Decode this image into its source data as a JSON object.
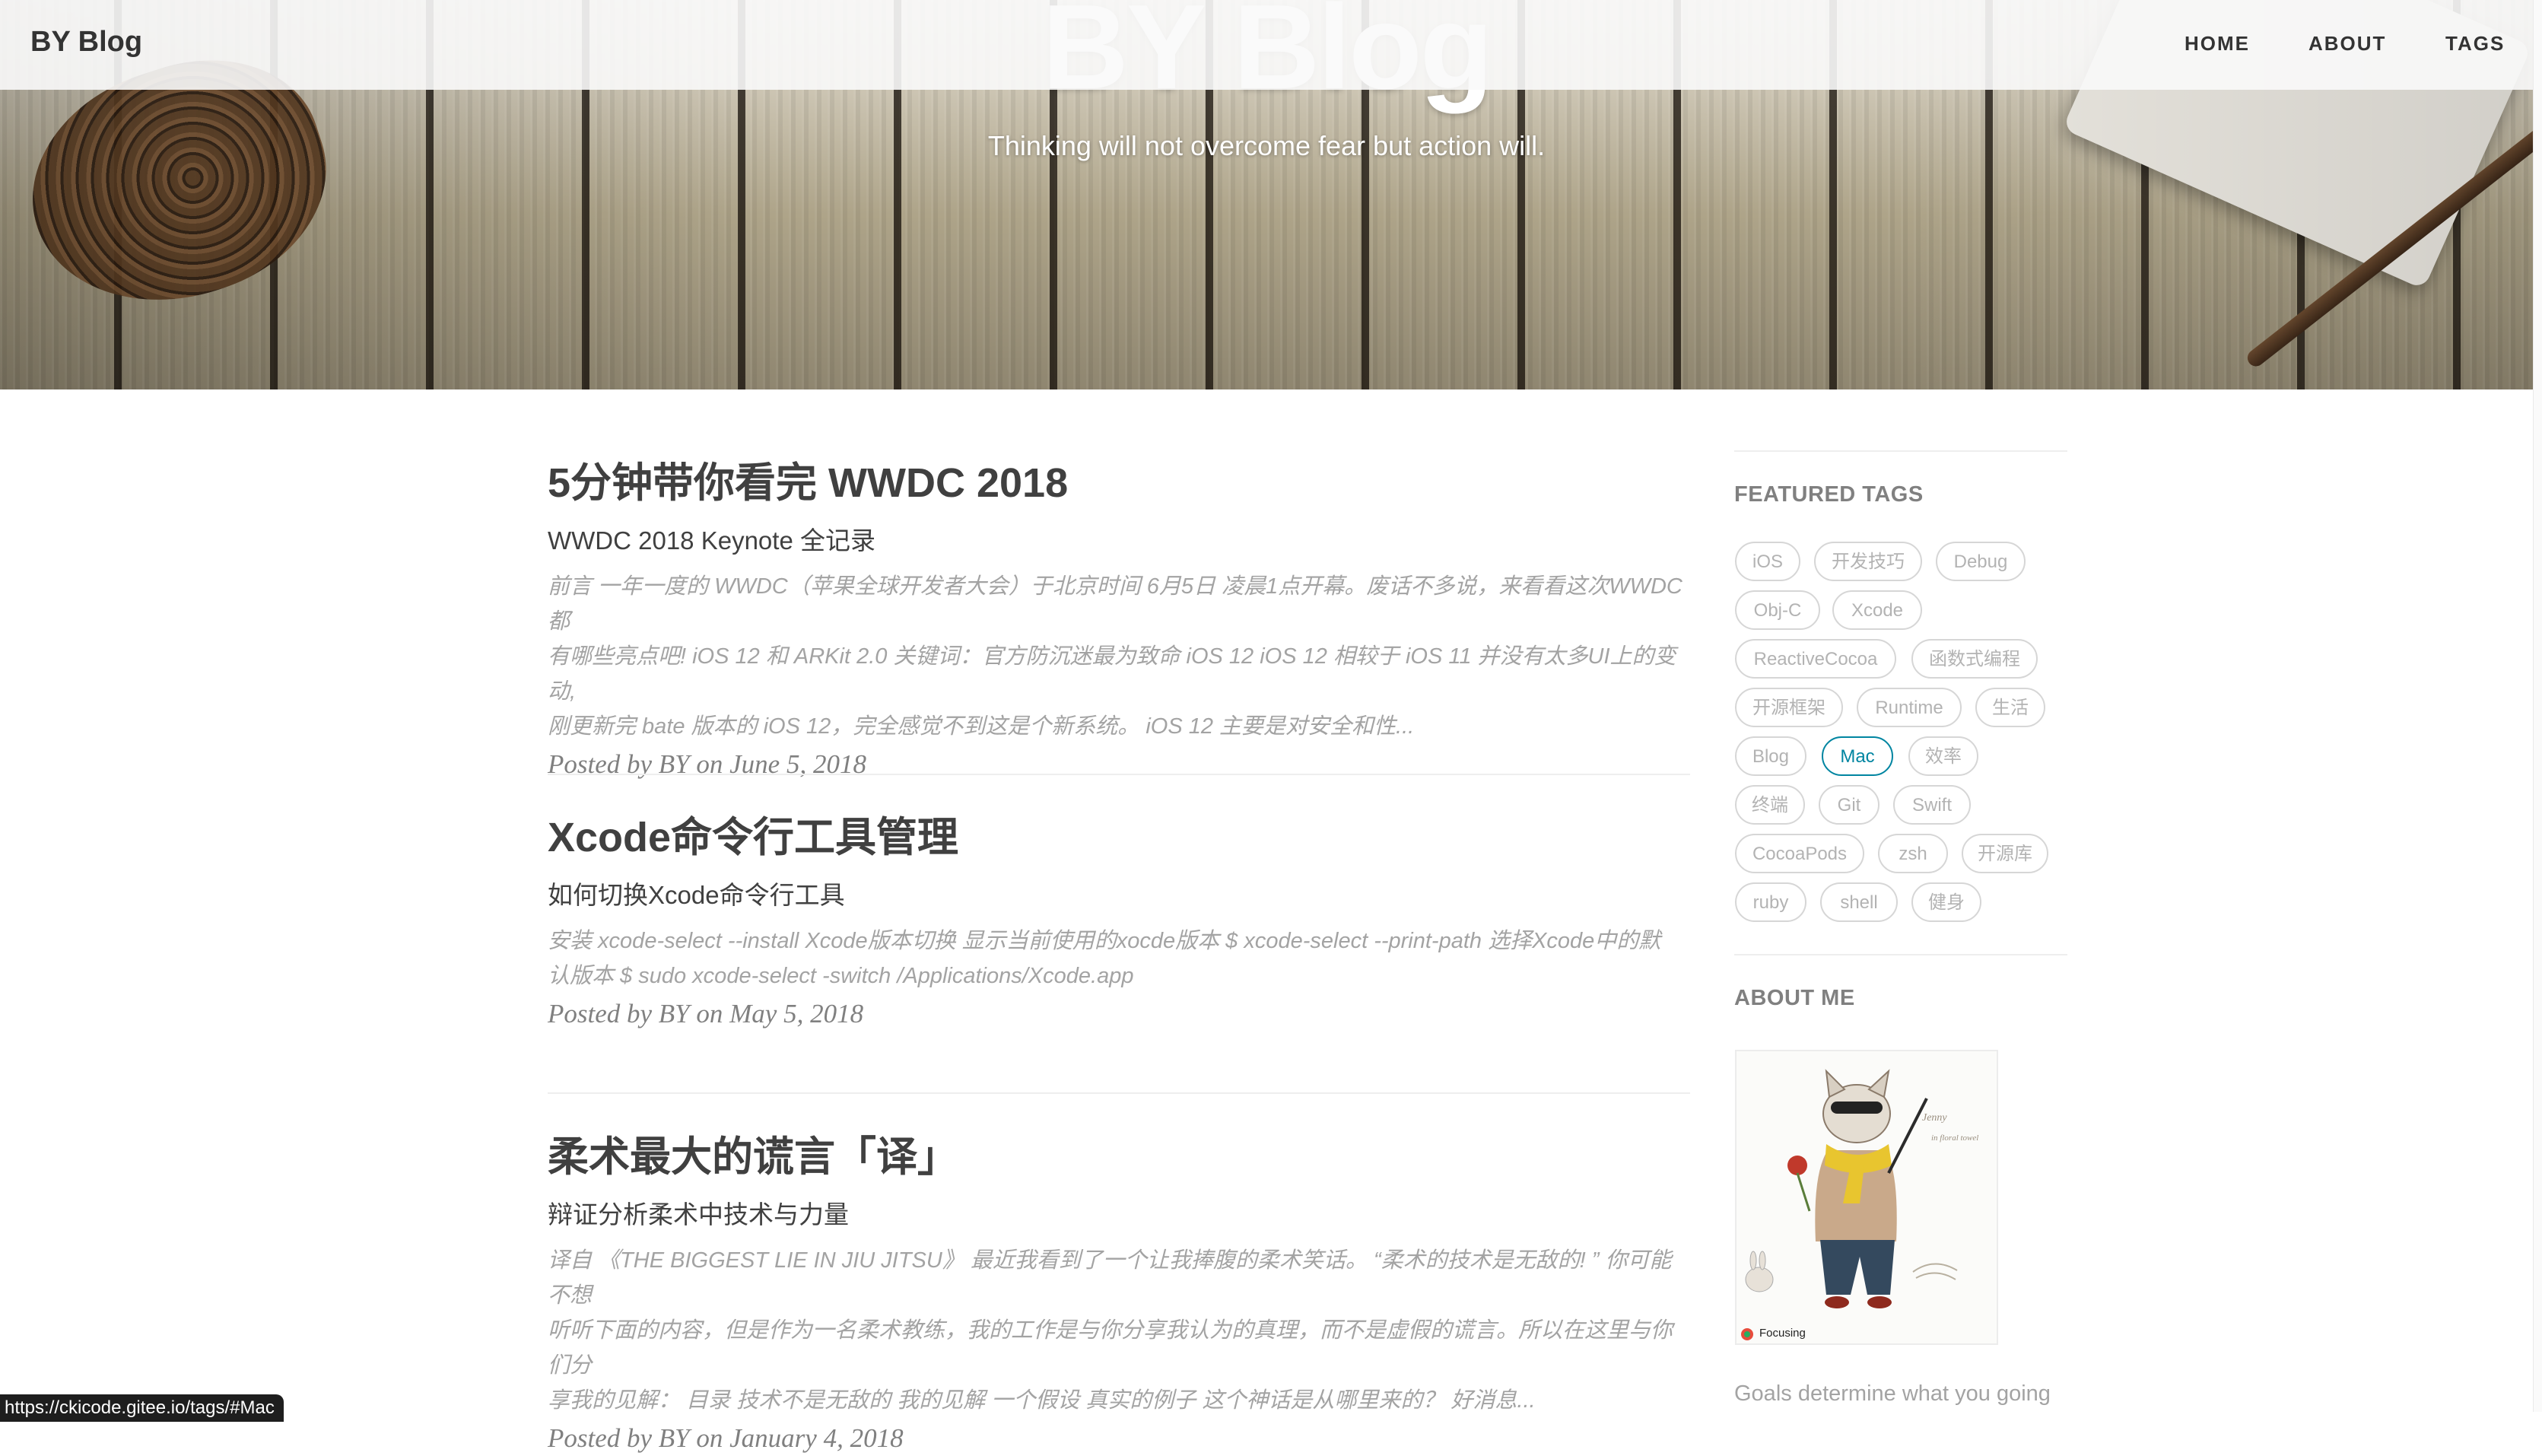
{
  "nav": {
    "brand": "BY Blog",
    "links": [
      "HOME",
      "ABOUT",
      "TAGS"
    ]
  },
  "hero": {
    "title": "BY Blog",
    "subtitle": "Thinking will not overcome fear but action will."
  },
  "posts": [
    {
      "title": "5分钟带你看完 WWDC 2018",
      "subtitle": "WWDC 2018 Keynote 全记录",
      "excerpt_lines": [
        "前言 一年一度的 WWDC（苹果全球开发者大会）于北京时间 6月5日 凌晨1点开幕。废话不多说，来看看这次WWDC 都",
        "有哪些亮点吧! iOS 12 和 ARKit 2.0 关键词：官方防沉迷最为致命 iOS 12 iOS 12 相较于 iOS 11 并没有太多UI上的变动,",
        "刚更新完 bate 版本的 iOS 12，完全感觉不到这是个新系统。 iOS 12 主要是对安全和性..."
      ],
      "meta": "Posted by BY on June 5, 2018"
    },
    {
      "title": "Xcode命令行工具管理",
      "subtitle": "如何切换Xcode命令行工具",
      "excerpt_lines": [
        "安装 xcode-select --install Xcode版本切换 显示当前使用的xocde版本 $ xcode-select --print-path 选择Xcode中的默",
        "认版本 $ sudo xcode-select -switch /Applications/Xcode.app"
      ],
      "meta": "Posted by BY on May 5, 2018"
    },
    {
      "title": "柔术最大的谎言「译」",
      "subtitle": "辩证分析柔术中技术与力量",
      "excerpt_lines": [
        "译自 《THE BIGGEST LIE IN JIU JITSU》 最近我看到了一个让我捧腹的柔术笑话。 “柔术的技术是无敌的! ” 你可能不想",
        "听听下面的内容，但是作为一名柔术教练，我的工作是与你分享我认为的真理，而不是虚假的谎言。所以在这里与你们分",
        "享我的见解： 目录 技术不是无敌的 我的见解 一个假设 真实的例子 这个神话是从哪里来的？ 好消息..."
      ],
      "meta": "Posted by BY on January 4, 2018"
    }
  ],
  "sidebar": {
    "featured_heading": "FEATURED TAGS",
    "tags": [
      "iOS",
      "开发技巧",
      "Debug",
      "Obj-C",
      "Xcode",
      "ReactiveCocoa",
      "函数式编程",
      "开源框架",
      "Runtime",
      "生活",
      "Blog",
      "Mac",
      "效率",
      "终端",
      "Git",
      "Swift",
      "CocoaPods",
      "zsh",
      "开源库",
      "ruby",
      "shell",
      "健身"
    ],
    "active_tag": "Mac",
    "about_heading": "ABOUT ME",
    "avatar_note_1": "Jenny",
    "avatar_note_2": "in floral towel",
    "avatar_status": "Focusing",
    "about_text": "Goals determine what you going"
  },
  "status_bar": {
    "url": "https://ckicode.gitee.io/tags/#Mac"
  },
  "colors": {
    "accent": "#0085a1",
    "text": "#404040",
    "muted": "#a3a3a3",
    "tag_border": "#d6d6d6"
  }
}
